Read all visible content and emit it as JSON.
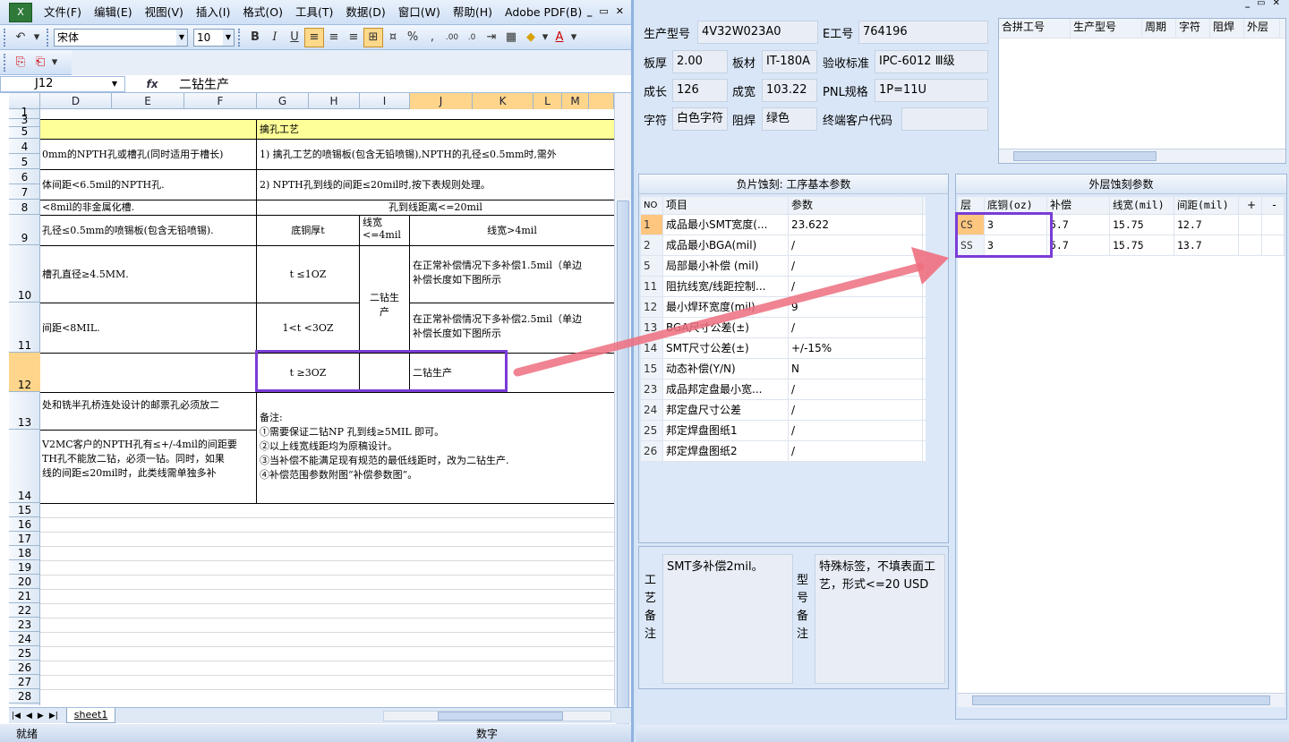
{
  "excel": {
    "menu": [
      "文件(F)",
      "编辑(E)",
      "视图(V)",
      "插入(I)",
      "格式(O)",
      "工具(T)",
      "数据(D)",
      "窗口(W)",
      "帮助(H)",
      "Adobe PDF(B)"
    ],
    "font_name": "宋体",
    "font_size": "10",
    "namebox": "J12",
    "fx": "fx",
    "formula": "二钻生产",
    "columns": [
      "D",
      "E",
      "F",
      "G",
      "H",
      "I",
      "J",
      "K",
      "L",
      "M"
    ],
    "rows": [
      "1",
      "3",
      "5",
      "4",
      "5",
      "6",
      "7",
      "8",
      "9",
      "10",
      "11",
      "12",
      "13",
      "14",
      "15",
      "16",
      "17",
      "18",
      "19",
      "20",
      "21",
      "22",
      "23",
      "24",
      "25",
      "26",
      "27",
      "28"
    ],
    "cells": {
      "title": "擒孔工艺",
      "r4l": "0mm的NPTH孔或槽孔(同时适用于槽长)",
      "r4r": "1) 擒孔工艺的喷锡板(包含无铅喷锡),NPTH的孔径≤0.5mm时,需外",
      "r6l": "体间距<6.5mil的NPTH孔.",
      "r6r": "2) NPTH孔到线的间距≤20mil时,按下表规则处理。",
      "r8l": "<8mil的非金属化槽.",
      "r8r": "孔到线距离<=20mil",
      "r9l": "孔径≤0.5mm的喷锡板(包含无铅喷锡).",
      "r9g": "底铜厚t",
      "r9i": "线宽\n<=4mil",
      "r9j": "线宽>4mil",
      "r10l": "槽孔直径≥4.5MM.",
      "r10g": "t ≤1OZ",
      "r10j": "在正常补偿情况下多补偿1.5mil（单边\n补偿长度如下图所示",
      "ri": "二钻生\n产",
      "r11l": "间距<8MIL.",
      "r11g": "1<t <3OZ",
      "r11j": "在正常补偿情况下多补偿2.5mil（单边\n补偿长度如下图所示",
      "r12g": "t ≥3OZ",
      "r12j": "二钻生产",
      "r13l": "处和铣半孔桥连处设计的邮票孔必须放二",
      "r14l": "V2MC客户的NPTH孔有≤+/-4mil的间距要\nTH孔不能放二钻，必须一钻。同时，如果\n线的间距≤20mil时，此类线需单独多补",
      "note": "备注:\n①需要保证二钻NP 孔到线≥5MIL 即可。\n②以上线宽线距均为原稿设计。\n③当补偿不能满足现有规范的最低线距时，改为二钻生产.\n④补偿范围参数附图“补偿参数图”。"
    },
    "sheet_tab": "sheet1",
    "status_left": "就绪",
    "status_right": "数字"
  },
  "app": {
    "fields": {
      "model_label": "生产型号",
      "model": "4V32W023A0",
      "eno_label": "E工号",
      "eno": "764196",
      "thick_label": "板厚",
      "thick": "2.00",
      "mat_label": "板材",
      "mat": "IT-180A",
      "std_label": "验收标准",
      "std": "IPC-6012 Ⅲ级",
      "len_label": "成长",
      "len": "126",
      "wid_label": "成宽",
      "wid": "103.22",
      "pnl_label": "PNL规格",
      "pnl": "1P=11U",
      "char_label": "字符",
      "char": "白色字符",
      "mask_label": "阻焊",
      "mask": "绿色",
      "cust_label": "终端客户代码",
      "cust": ""
    },
    "merge_headers": [
      "合拼工号",
      "生产型号",
      "周期",
      "字符",
      "阻焊",
      "外层"
    ],
    "neg_title": "负片蚀刻: 工序基本参数",
    "neg_headers": [
      "NO",
      "项目",
      "参数"
    ],
    "neg_rows": [
      {
        "no": "1",
        "item": "成品最小SMT宽度(...",
        "val": "23.622"
      },
      {
        "no": "2",
        "item": "成品最小BGA(mil)",
        "val": "/"
      },
      {
        "no": "5",
        "item": "局部最小补偿 (mil)",
        "val": "/"
      },
      {
        "no": "11",
        "item": "阻抗线宽/线距控制...",
        "val": "/"
      },
      {
        "no": "12",
        "item": "最小焊环宽度(mil)",
        "val": "9"
      },
      {
        "no": "13",
        "item": "BGA尺寸公差(±)",
        "val": "/"
      },
      {
        "no": "14",
        "item": "SMT尺寸公差(±)",
        "val": "+/-15%"
      },
      {
        "no": "15",
        "item": "动态补偿(Y/N)",
        "val": "N"
      },
      {
        "no": "23",
        "item": "成品邦定盘最小宽...",
        "val": "/"
      },
      {
        "no": "24",
        "item": "邦定盘尺寸公差",
        "val": "/"
      },
      {
        "no": "25",
        "item": "邦定焊盘图纸1",
        "val": "/"
      },
      {
        "no": "26",
        "item": "邦定焊盘图纸2",
        "val": "/"
      }
    ],
    "outer_title": "外层蚀刻参数",
    "outer_headers": [
      "层",
      "底铜(oz)",
      "补偿",
      "线宽(mil)",
      "间距(mil)",
      "+",
      "-"
    ],
    "outer_rows": [
      {
        "layer": "CS",
        "cu": "3",
        "comp": "5.7",
        "lw": "15.75",
        "sp": "12.7"
      },
      {
        "layer": "SS",
        "cu": "3",
        "comp": "5.7",
        "lw": "15.75",
        "sp": "13.7"
      }
    ],
    "proc_label": "工\n艺\n备\n注",
    "proc_note": "SMT多补偿2mil。",
    "model_note_label": "型\n号\n备\n注",
    "model_note": "特殊标签，不填表面工艺，形式<=20 USD"
  },
  "colors": {
    "highlight": "#7a3cd6",
    "arrow": "#ee6f7f",
    "selected": "#ffd58c"
  }
}
